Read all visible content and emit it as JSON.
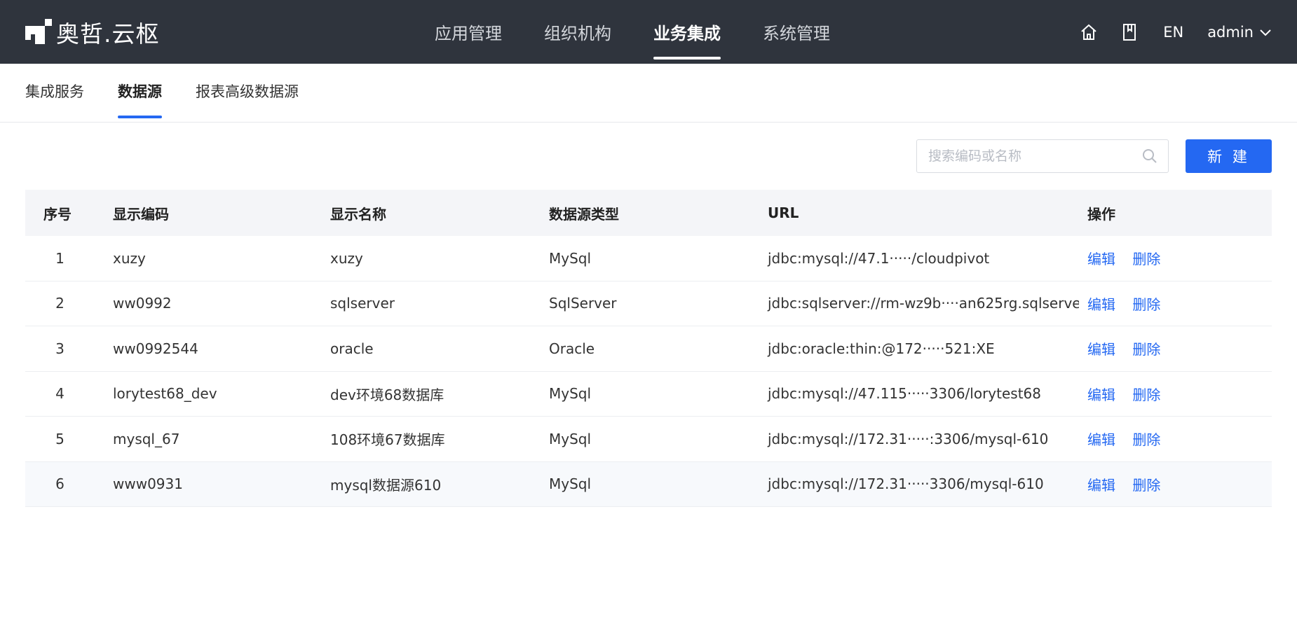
{
  "brand": {
    "name": "奥哲.云枢"
  },
  "main_nav": [
    {
      "label": "应用管理",
      "active": false
    },
    {
      "label": "组织机构",
      "active": false
    },
    {
      "label": "业务集成",
      "active": true
    },
    {
      "label": "系统管理",
      "active": false
    }
  ],
  "header_tools": {
    "home_icon": "home-icon",
    "doc_icon": "bookmark-icon",
    "lang": "EN",
    "user": "admin"
  },
  "sub_tabs": [
    {
      "label": "集成服务",
      "active": false
    },
    {
      "label": "数据源",
      "active": true
    },
    {
      "label": "报表高级数据源",
      "active": false
    }
  ],
  "search": {
    "placeholder": "搜索编码或名称",
    "value": ""
  },
  "actions": {
    "new_label": "新 建"
  },
  "table": {
    "columns": [
      "序号",
      "显示编码",
      "显示名称",
      "数据源类型",
      "URL",
      "操作"
    ],
    "op_edit": "编辑",
    "op_delete": "删除",
    "rows": [
      {
        "index": "1",
        "code": "xuzy",
        "name": "xuzy",
        "type": "MySql",
        "url": "jdbc:mysql://47.1·····/cloudpivot"
      },
      {
        "index": "2",
        "code": "ww0992",
        "name": "sqlserver",
        "type": "SqlServer",
        "url": "jdbc:sqlserver://rm-wz9b····an625rg.sqlserve"
      },
      {
        "index": "3",
        "code": "ww0992544",
        "name": "oracle",
        "type": "Oracle",
        "url": "jdbc:oracle:thin:@172·····521:XE"
      },
      {
        "index": "4",
        "code": "lorytest68_dev",
        "name": "dev环境68数据库",
        "type": "MySql",
        "url": "jdbc:mysql://47.115·····3306/lorytest68"
      },
      {
        "index": "5",
        "code": "mysql_67",
        "name": "108环境67数据库",
        "type": "MySql",
        "url": "jdbc:mysql://172.31·····:3306/mysql-610"
      },
      {
        "index": "6",
        "code": "www0931",
        "name": "mysql数据源610",
        "type": "MySql",
        "url": "jdbc:mysql://172.31·····3306/mysql-610"
      }
    ]
  },
  "colors": {
    "header_bg": "#2f343d",
    "primary": "#2468f2",
    "table_head_bg": "#f4f5f8"
  }
}
